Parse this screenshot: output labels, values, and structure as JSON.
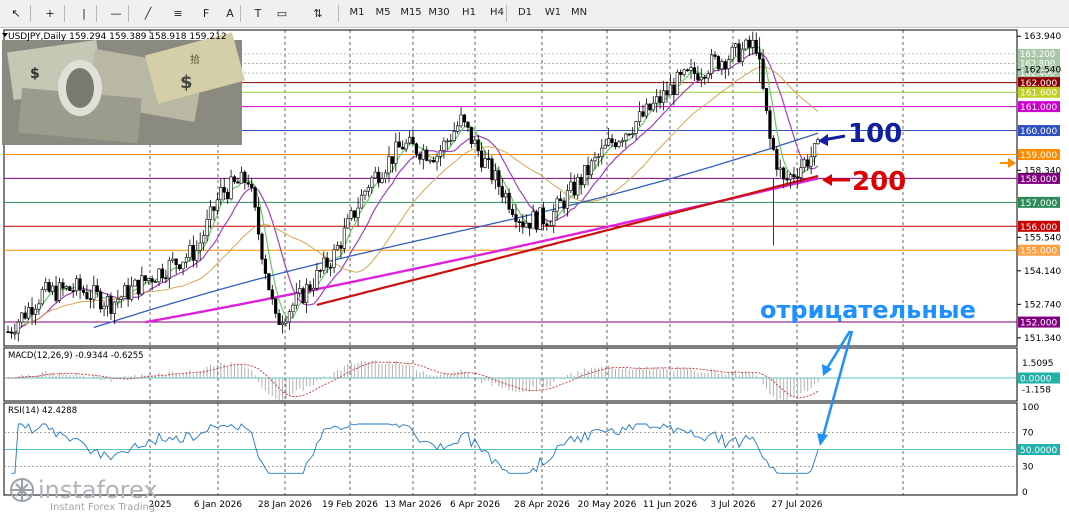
{
  "toolbar": {
    "tools": [
      {
        "name": "cursor-tool",
        "glyph": "↖"
      },
      {
        "name": "crosshair-tool",
        "glyph": "+"
      },
      {
        "name": "vertical-line-tool",
        "glyph": "|"
      },
      {
        "name": "horizontal-line-tool",
        "glyph": "—"
      },
      {
        "name": "trendline-tool",
        "glyph": "╱"
      },
      {
        "name": "equidistant-channel-tool",
        "glyph": "≡"
      },
      {
        "name": "fibonacci-tool",
        "glyph": "F"
      },
      {
        "name": "text-tool",
        "glyph": "A"
      },
      {
        "name": "text-label-tool",
        "glyph": "T"
      },
      {
        "name": "rectangle-tool",
        "glyph": "▭"
      },
      {
        "name": "arrows-tool",
        "glyph": "⇅"
      }
    ],
    "timeframes": [
      "M1",
      "M5",
      "M15",
      "M30",
      "H1",
      "H4",
      "D1",
      "W1",
      "MN"
    ]
  },
  "chart_data": {
    "type": "candlestick",
    "symbol_header": "USDJPY,Daily  159.294 159.389 158.918 159.212",
    "x_labels": [
      "2025",
      "6 Jan 2026",
      "28 Jan 2026",
      "19 Feb 2026",
      "13 Mar 2026",
      "6 Apr 2026",
      "28 Apr 2026",
      "20 May 2026",
      "11 Jun 2026",
      "3 Jul 2026",
      "27 Jul 2026"
    ],
    "y_ticks": [
      "163.940",
      "162.540",
      "158.340",
      "155.540",
      "154.140",
      "152.740",
      "151.340"
    ],
    "y_range": [
      151.0,
      164.2
    ],
    "levels": [
      {
        "value": "162.000",
        "color": "#8b0000",
        "bg": "#8b0000"
      },
      {
        "value": "161.600",
        "color": "#9acd32",
        "bg": "#c0d020"
      },
      {
        "value": "161.000",
        "color": "#cc00cc",
        "bg": "#cc00cc"
      },
      {
        "value": "160.000",
        "color": "#3050c0",
        "bg": "#3050c0"
      },
      {
        "value": "159.000",
        "color": "#ff8c00",
        "bg": "#ff8c00"
      },
      {
        "value": "158.000",
        "color": "#800080",
        "bg": "#800080"
      },
      {
        "value": "157.000",
        "color": "#2e8b57",
        "bg": "#2e8b57"
      },
      {
        "value": "156.000",
        "color": "#cc0000",
        "bg": "#cc0000"
      },
      {
        "value": "155.000",
        "color": "#ff8c00",
        "bg": "#ff9f40"
      },
      {
        "value": "152.000",
        "color": "#800080",
        "bg": "#800080"
      }
    ],
    "faint_levels": [
      "163.200",
      "162.800",
      "162.400"
    ],
    "annotations": {
      "ma100_label": "100",
      "ma200_label": "200",
      "negative_label": "отрицательные"
    },
    "macd": {
      "header": "MACD(12,26,9) -0.9344 -0.6255",
      "ticks": [
        "1.5095",
        "0.0000",
        "-1.158"
      ]
    },
    "rsi": {
      "header": "RSI(14) 42.4288",
      "ticks": [
        "100",
        "70",
        "50.0000",
        "30",
        "0"
      ]
    }
  },
  "watermark": {
    "brand": "instaforex",
    "tagline": "Instant Forex Trading"
  },
  "colors": {
    "candle": "#000000",
    "ma_green": "#66cc66",
    "ma_purple": "#a040c0",
    "ma_orange": "#d4a040",
    "ma100": "#3060c0",
    "ma200": "#cc1111",
    "ma_magenta": "#dd22dd",
    "annotation_blue": "#1e90ff",
    "annotation_red": "#dd0000"
  }
}
